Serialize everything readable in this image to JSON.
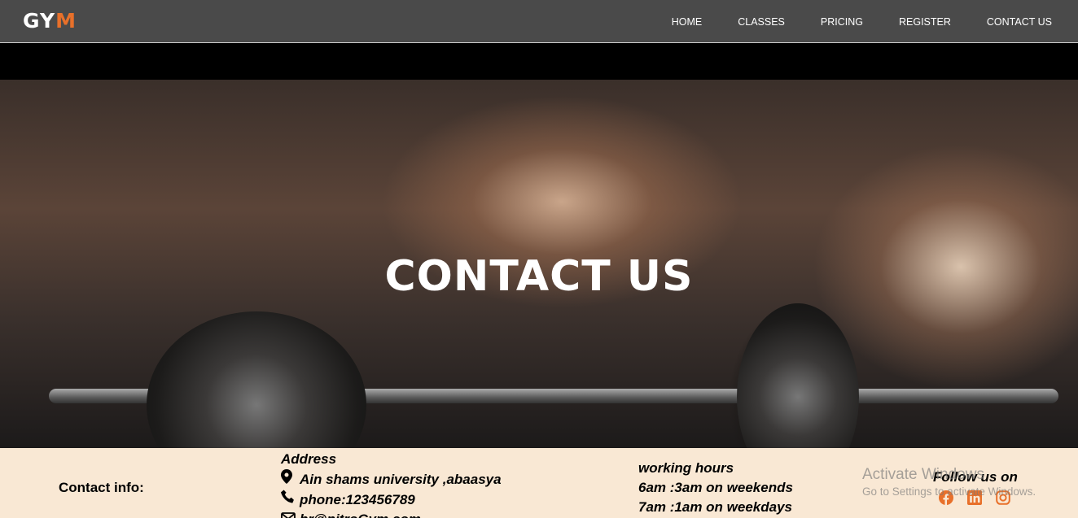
{
  "nav": {
    "logo_part1": "GY",
    "logo_part2": "M",
    "links": [
      "HOME",
      "CLASSES",
      "PRICING",
      "REGISTER",
      "CONTACT US"
    ]
  },
  "hero": {
    "title": "CONTACT US"
  },
  "info": {
    "contact_label": "Contact info:",
    "address_heading": "Address",
    "address_line": "Ain shams university ,abaasya",
    "phone": "phone:123456789",
    "email": "hr@nitroGym.com",
    "hours_heading": "working hours",
    "hours_weekends": "6am :3am on weekends",
    "hours_weekdays": "7am :1am on weekdays",
    "follow_label": "Follow us on"
  },
  "icons": [
    "location-pin-icon",
    "phone-icon",
    "envelope-icon",
    "facebook-icon",
    "linkedin-icon",
    "instagram-icon"
  ],
  "colors": {
    "accent": "#e8702a",
    "navbar": "#4a4a4a",
    "info_bg": "#f9e8d4"
  },
  "watermark": {
    "line1": "Activate Windows",
    "line2": "Go to Settings to activate Windows."
  }
}
